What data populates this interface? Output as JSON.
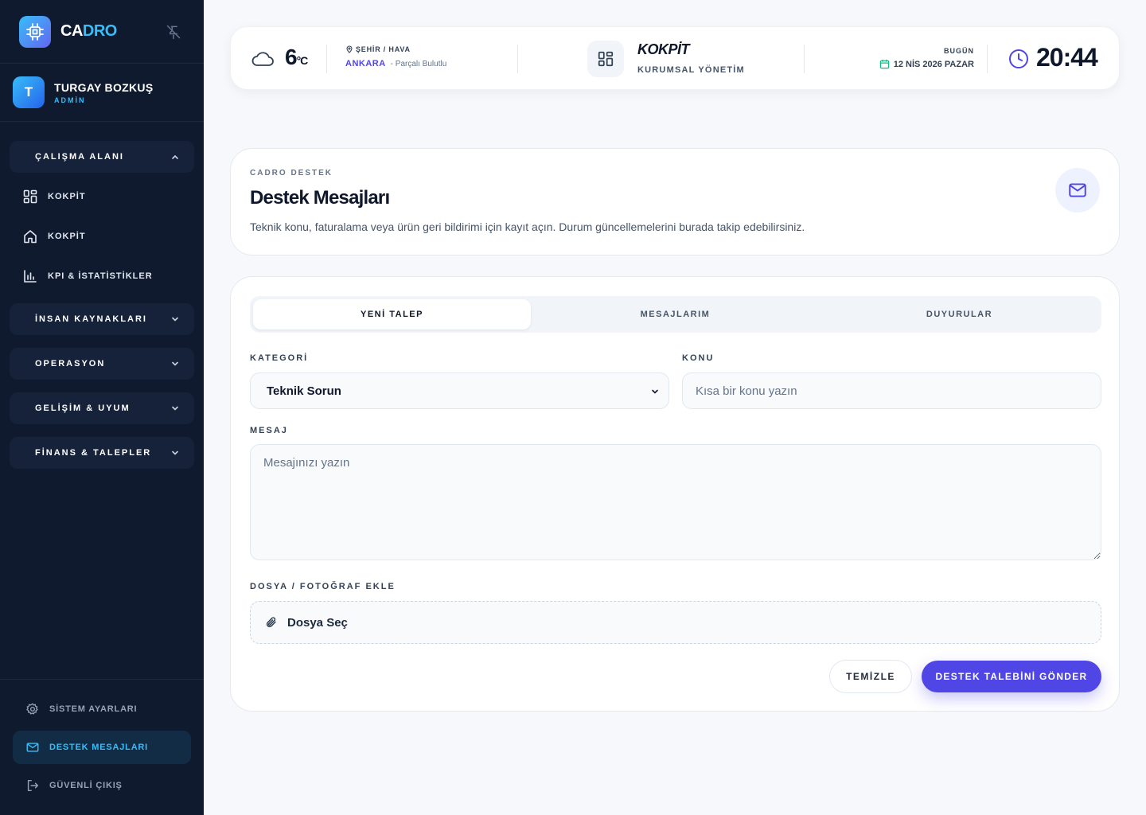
{
  "brand": {
    "name_part1": "CA",
    "name_part2": "DRO"
  },
  "user": {
    "initial": "T",
    "name": "TURGAY BOZKUŞ",
    "role": "ADMİN"
  },
  "sidebar": {
    "groups": [
      {
        "label": "ÇALIŞMA ALANI",
        "expanded": true
      },
      {
        "label": "İNSAN KAYNAKLARI",
        "expanded": false
      },
      {
        "label": "OPERASYON",
        "expanded": false
      },
      {
        "label": "GELİŞİM & UYUM",
        "expanded": false
      },
      {
        "label": "FİNANS & TALEPLER",
        "expanded": false
      }
    ],
    "items": [
      {
        "label": "KOKPİT",
        "icon": "grid-icon"
      },
      {
        "label": "KOKPİT",
        "icon": "home-icon"
      },
      {
        "label": "KPI & İSTATİSTİKLER",
        "icon": "bar-chart-icon"
      }
    ],
    "bottom": [
      {
        "label": "SİSTEM AYARLARI",
        "icon": "gear-icon",
        "active": false
      },
      {
        "label": "DESTEK MESAJLARI",
        "icon": "mail-icon",
        "active": true
      },
      {
        "label": "GÜVENLİ ÇIKIŞ",
        "icon": "logout-icon",
        "active": false
      }
    ]
  },
  "header": {
    "weather": {
      "temp": "6",
      "unit": "°C",
      "label": "ŞEHİR / HAVA",
      "city": "ANKARA",
      "condition": "- Parçalı Bulutlu"
    },
    "cockpit": {
      "title": "KOKPİT",
      "subtitle": "KURUMSAL YÖNETİM"
    },
    "today": {
      "label": "BUGÜN",
      "date": "12 NİS 2026 PAZAR"
    },
    "time": "20:44"
  },
  "intro": {
    "kicker": "CADRO DESTEK",
    "title": "Destek Mesajları",
    "description": "Teknik konu, faturalama veya ürün geri bildirimi için kayıt açın. Durum güncellemelerini burada takip edebilirsiniz."
  },
  "tabs": [
    {
      "label": "YENİ TALEP",
      "active": true
    },
    {
      "label": "MESAJLARIM",
      "active": false
    },
    {
      "label": "DUYURULAR",
      "active": false
    }
  ],
  "form": {
    "category_label": "KATEGORİ",
    "category_value": "Teknik Sorun",
    "subject_label": "KONU",
    "subject_placeholder": "Kısa bir konu yazın",
    "message_label": "MESAJ",
    "message_placeholder": "Mesajınızı yazın",
    "file_label": "DOSYA / FOTOĞRAF EKLE",
    "file_button": "Dosya Seç",
    "clear_button": "TEMİZLE",
    "submit_button": "DESTEK TALEBİNİ GÖNDER"
  },
  "colors": {
    "sidebar_bg": "#0f1a2e",
    "accent": "#4f46e5",
    "brand_cyan": "#38bdf8",
    "page_bg": "#f6f8fb"
  }
}
